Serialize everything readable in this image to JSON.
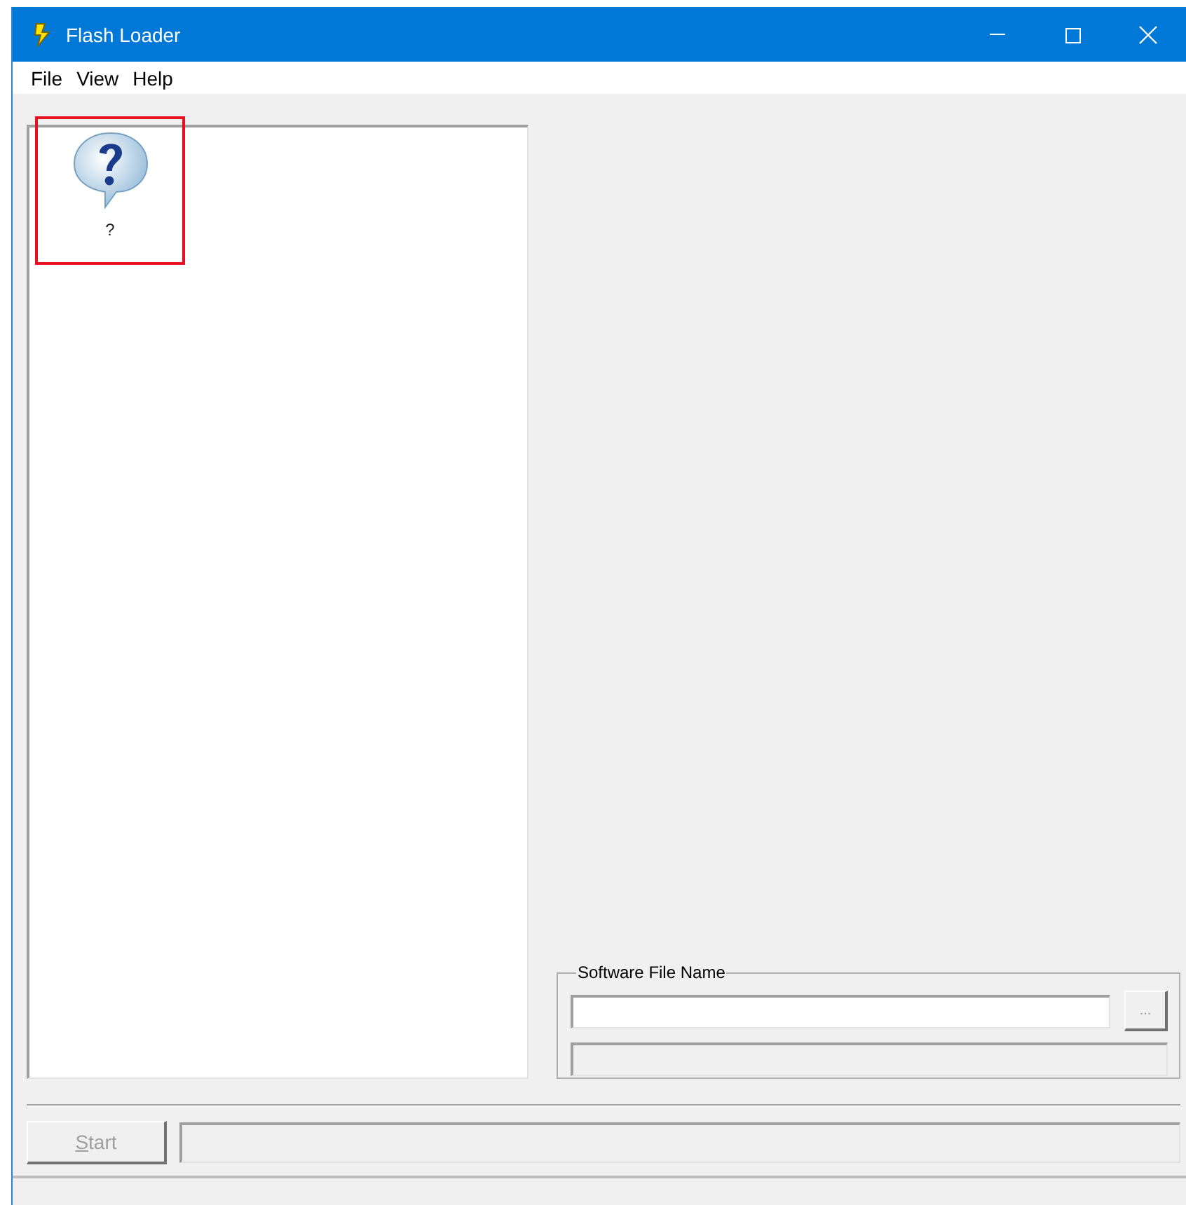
{
  "window": {
    "title": "Flash Loader"
  },
  "menu": [
    "File",
    "View",
    "Help"
  ],
  "device_list": {
    "items": [
      {
        "label": "?",
        "annotated": true
      }
    ]
  },
  "software_file": {
    "legend": "Software File Name",
    "browse_button": {
      "label": "...",
      "disabled": true
    }
  },
  "start_button": {
    "label": "Start",
    "access_key_underlined": true,
    "disabled": true
  }
}
